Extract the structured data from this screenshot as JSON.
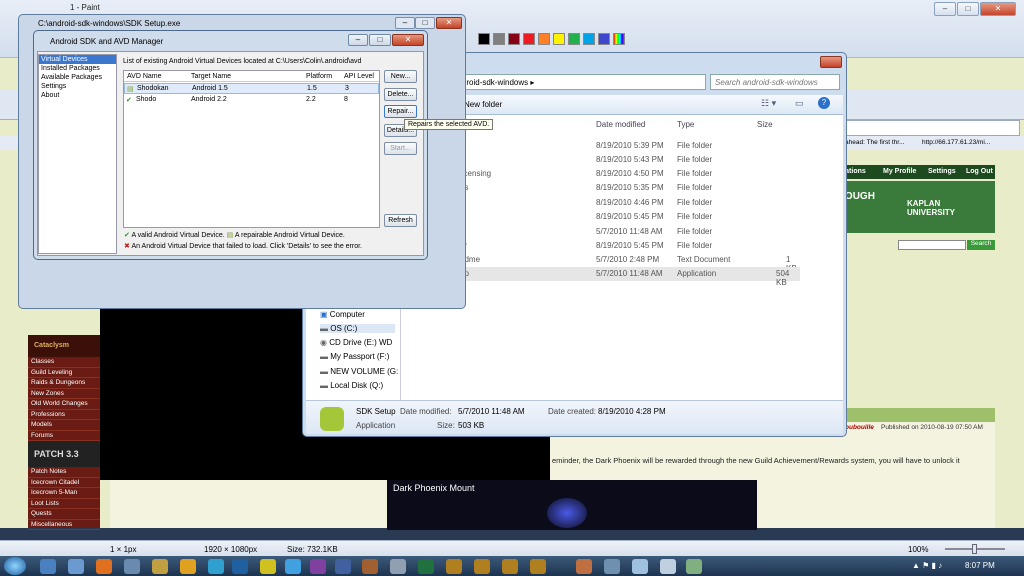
{
  "paint": {
    "title": "1 - Paint"
  },
  "browser": {
    "url": "http://66.177.61.23/mi...",
    "tab_text": "ahead: The first thr...",
    "nav_items": [
      "fications",
      "My Profile",
      "Settings",
      "Log Out"
    ],
    "kaplan_line1": "TOUGH",
    "kaplan_line2": "KAPLAN UNIVERSITY",
    "search_btn": "Search",
    "left_menu_heading": "Cataclysm",
    "left_menu": [
      "Classes",
      "Guild Leveling",
      "Raids & Dungeons",
      "New Zones",
      "Old World Changes",
      "Professions",
      "Models",
      "Forums"
    ],
    "patch_heading": "PATCH 3.3",
    "patch_menu": [
      "Patch Notes",
      "Icecrown Citadel",
      "Icecrown 5-Man",
      "Loot Lists",
      "Quests",
      "Miscellaneous"
    ],
    "author": "oubouille",
    "published": "Published on 2010-08-19 07:50 AM",
    "article_text": "eminder, the Dark Phoenix will be rewarded through the new Guild Achievement/Rewards system, you will have to unlock it",
    "dark_phoenix_title": "Dark Phoenix Mount"
  },
  "sdk_setup": {
    "title": "C:\\android-sdk-windows\\SDK Setup.exe"
  },
  "explorer": {
    "address": "android-sdk-windows ▸",
    "search_placeholder": "Search android-sdk-windows",
    "new_folder": "New folder",
    "columns": {
      "date": "Date modified",
      "type": "Type",
      "size": "Size"
    },
    "files": [
      {
        "name": "s",
        "date": "8/19/2010 5:39 PM",
        "type": "File folder",
        "size": ""
      },
      {
        "name": "",
        "date": "8/19/2010 5:43 PM",
        "type": "File folder",
        "size": ""
      },
      {
        "name": "licensing",
        "date": "8/19/2010 4:50 PM",
        "type": "File folder",
        "size": ""
      },
      {
        "name": "ns",
        "date": "8/19/2010 5:35 PM",
        "type": "File folder",
        "size": ""
      },
      {
        "name": "",
        "date": "8/19/2010 4:46 PM",
        "type": "File folder",
        "size": ""
      },
      {
        "name": "",
        "date": "8/19/2010 5:45 PM",
        "type": "File folder",
        "size": ""
      },
      {
        "name": "",
        "date": "5/7/2010 11:48 AM",
        "type": "File folder",
        "size": ""
      },
      {
        "name": "er",
        "date": "8/19/2010 5:45 PM",
        "type": "File folder",
        "size": ""
      },
      {
        "name": "adme",
        "date": "5/7/2010 2:48 PM",
        "type": "Text Document",
        "size": "1 KB"
      },
      {
        "name": "up",
        "date": "5/7/2010 11:48 AM",
        "type": "Application",
        "size": "504 KB"
      }
    ],
    "nav_tree": [
      "Computer",
      "OS (C:)",
      "CD Drive (E:) WD",
      "My Passport (F:)",
      "NEW VOLUME (G:",
      "Local Disk (Q:)"
    ],
    "details": {
      "name": "SDK Setup",
      "kind": "Application",
      "date_modified_label": "Date modified:",
      "date_modified": "5/7/2010 11:48 AM",
      "date_created_label": "Date created:",
      "date_created": "8/19/2010 4:28 PM",
      "size_label": "Size:",
      "size": "503 KB"
    }
  },
  "avd_manager": {
    "title": "Android SDK and AVD Manager",
    "sidebar": [
      "Virtual Devices",
      "Installed Packages",
      "Available Packages",
      "Settings",
      "About"
    ],
    "list_label": "List of existing Android Virtual Devices located at C:\\Users\\Colin\\.android\\avd",
    "columns": [
      "AVD Name",
      "Target Name",
      "Platform",
      "API Level"
    ],
    "rows": [
      {
        "name": "Shodokan",
        "target": "Android 1.5",
        "platform": "1.5",
        "api": "3"
      },
      {
        "name": "Shodo",
        "target": "Android 2.2",
        "platform": "2.2",
        "api": "8"
      }
    ],
    "buttons": {
      "new": "New...",
      "delete": "Delete...",
      "repair": "Repair...",
      "details": "Details...",
      "start": "Start...",
      "refresh": "Refresh"
    },
    "tooltip": "Repairs the selected AVD.",
    "legend1": "A valid Android Virtual Device.",
    "legend2": "A repairable Android Virtual Device.",
    "legend3": "An Android Virtual Device that failed to load. Click 'Details' to see the error."
  },
  "statusbar": {
    "cursor": "1 × 1px",
    "dimensions": "1920 × 1080px",
    "size": "Size: 732.1KB",
    "zoom": "100%"
  },
  "taskbar": {
    "time": "8:07 PM"
  },
  "colors": {
    "accent": "#3a78d0",
    "taskbar": "#1d3350",
    "site_green": "#3a7a3a",
    "site_red": "#6a1c14"
  }
}
